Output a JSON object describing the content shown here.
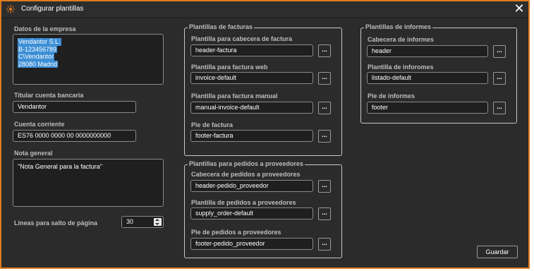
{
  "window": {
    "title": "Configurar plantillas",
    "close_glyph": "✕"
  },
  "left": {
    "company_label": "Datos de la empresa",
    "company_lines": [
      "Vendantor S.L.",
      "B-123456789",
      "C\\Vendantor",
      "28080 Madrid"
    ],
    "bank_holder_label": "Titular cuenta bancaria",
    "bank_holder_value": "Vendantor",
    "account_label": "Cuenta corriente",
    "account_value": "ES76 0000 0000 00 0000000000",
    "note_label": "Nota general",
    "note_value": "\"Nota General para la factura\"",
    "lines_label": "Lineas para salto de página",
    "lines_value": "30"
  },
  "invoices": {
    "title": "Plantillas de facturas",
    "header_label": "Plantilla para cabecera de factura",
    "header_value": "header-factura",
    "web_label": "Plantilla para factura web",
    "web_value": "invoice-default",
    "manual_label": "Plantilla para factura manual",
    "manual_value": "manual-invoice-default",
    "footer_label": "Pie de factura",
    "footer_value": "footer-factura"
  },
  "supplier": {
    "title": "Plantillas para pedidos a proveedores",
    "header_label": "Cabecera de pedidos a proveedores",
    "header_value": "header-pedido_proveedor",
    "template_label": "Plantilla de pedidos a proveedores",
    "template_value": "supply_order-default",
    "footer_label": "Pie de pedidos a proveedores",
    "footer_value": "footer-pedido_proveedor"
  },
  "reports": {
    "title": "Plantillas de informes",
    "header_label": "Cabecera de informes",
    "header_value": "header",
    "template_label": "Plantilla de inforomes",
    "template_value": "listado-default",
    "footer_label": "Pie de informes",
    "footer_value": "footer"
  },
  "browse_label": "...",
  "save_label": "Guardar",
  "colors": {
    "accent": "#e07a1f",
    "background": "#2b2b2b",
    "selection": "#3d8fd6"
  }
}
